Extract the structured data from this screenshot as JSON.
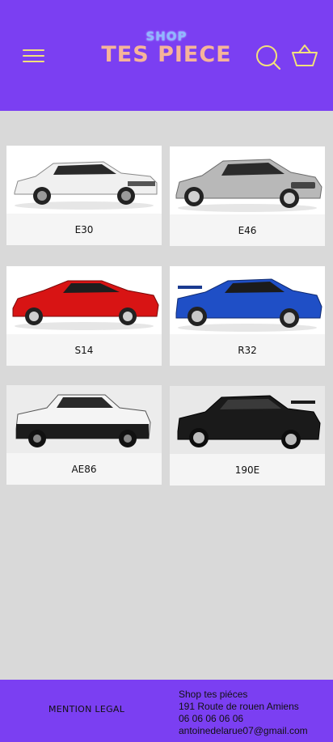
{
  "header": {
    "logo_top": "SHOP",
    "logo_main": "TES PIECE",
    "icons": {
      "menu": "menu-icon",
      "search": "search-icon",
      "basket": "basket-icon"
    },
    "colors": {
      "bar": "#7b3ff2",
      "icon": "#f2e17a",
      "logo_main": "#f6b49a",
      "logo_top": "#8fb8ff"
    }
  },
  "cars": [
    {
      "label": "E30",
      "color": "#f0f0f0"
    },
    {
      "label": "E46",
      "color": "#b8b8b8"
    },
    {
      "label": "S14",
      "color": "#d81414"
    },
    {
      "label": "R32",
      "color": "#1f4fc6"
    },
    {
      "label": "AE86",
      "color": "#f4f4f4"
    },
    {
      "label": "190E",
      "color": "#1a1a1a"
    }
  ],
  "footer": {
    "mention_label": "MENTION LEGAL",
    "contact": {
      "name": "Shop tes piéces",
      "address": "191 Route de rouen Amiens",
      "phone": "06 06 06 06 06",
      "email": "antoinedelarue07@gmail.com"
    }
  }
}
